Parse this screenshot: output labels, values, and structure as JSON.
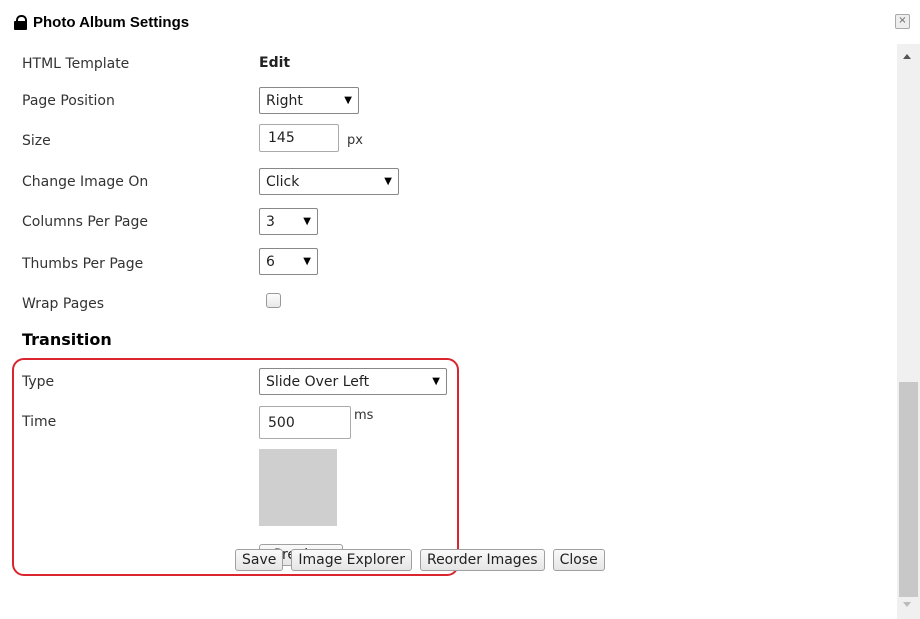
{
  "window": {
    "title": "Photo Album Settings",
    "close_symbol": "×"
  },
  "fields": {
    "html_template": {
      "label": "HTML Template",
      "value": "Edit"
    },
    "page_position": {
      "label": "Page Position",
      "value": "Right"
    },
    "size": {
      "label": "Size",
      "value": "145",
      "unit": "px"
    },
    "change_image_on": {
      "label": "Change Image On",
      "value": "Click"
    },
    "columns_per_page": {
      "label": "Columns Per Page",
      "value": "3"
    },
    "thumbs_per_page": {
      "label": "Thumbs Per Page",
      "value": "6"
    },
    "wrap_pages": {
      "label": "Wrap Pages",
      "checked": false
    }
  },
  "transition": {
    "heading": "Transition",
    "type": {
      "label": "Type",
      "value": "Slide Over Left"
    },
    "time": {
      "label": "Time",
      "value": "500",
      "unit": "ms"
    },
    "preview_button": "Preview"
  },
  "footer": {
    "save": "Save",
    "image_explorer": "Image Explorer",
    "reorder_images": "Reorder Images",
    "close": "Close"
  },
  "colors": {
    "highlight_border": "#d9252e",
    "preview_box": "#cfcfcf"
  },
  "icons": {
    "lock": "lock-icon",
    "close": "close-icon",
    "dropdown": "dropdown-arrow-icon"
  }
}
